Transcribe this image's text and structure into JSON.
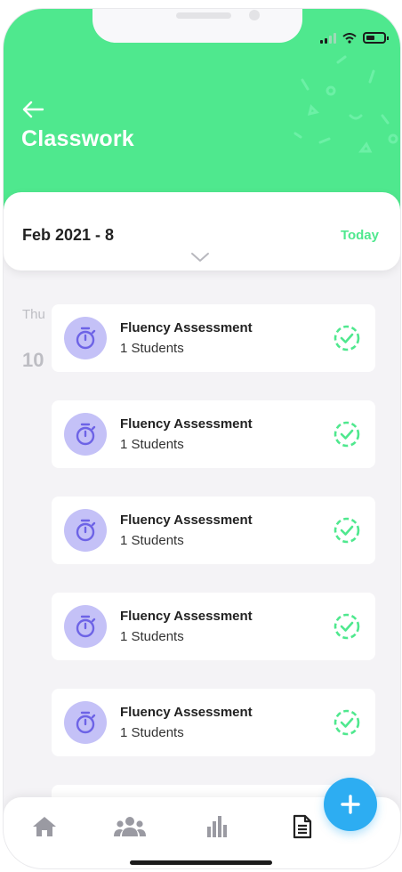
{
  "header": {
    "title": "Classwork",
    "bg_color": "#4fe88e"
  },
  "date_selector": {
    "label": "Feb 2021 - 8",
    "today_label": "Today"
  },
  "day": {
    "weekday": "Thu",
    "date": "10"
  },
  "assignments": [
    {
      "title": "Fluency Assessment",
      "subtitle": "1 Students",
      "icon": "stopwatch-icon",
      "status_icon": "check-circle-icon"
    },
    {
      "title": "Fluency Assessment",
      "subtitle": "1 Students",
      "icon": "stopwatch-icon",
      "status_icon": "check-circle-icon"
    },
    {
      "title": "Fluency Assessment",
      "subtitle": "1 Students",
      "icon": "stopwatch-icon",
      "status_icon": "check-circle-icon"
    },
    {
      "title": "Fluency Assessment",
      "subtitle": "1 Students",
      "icon": "stopwatch-icon",
      "status_icon": "check-circle-icon"
    },
    {
      "title": "Fluency Assessment",
      "subtitle": "1 Students",
      "icon": "stopwatch-icon",
      "status_icon": "check-circle-icon"
    }
  ],
  "tabs": [
    {
      "icon": "home-icon"
    },
    {
      "icon": "people-icon"
    },
    {
      "icon": "bar-chart-icon"
    },
    {
      "icon": "document-icon",
      "active": true
    }
  ],
  "fab": {
    "icon": "plus-icon",
    "color": "#2dadf2"
  },
  "colors": {
    "accent_green": "#4fe88e",
    "avatar_purple": "#c4c1f7",
    "icon_purple": "#6d63e6",
    "fab_blue": "#2dadf2"
  }
}
